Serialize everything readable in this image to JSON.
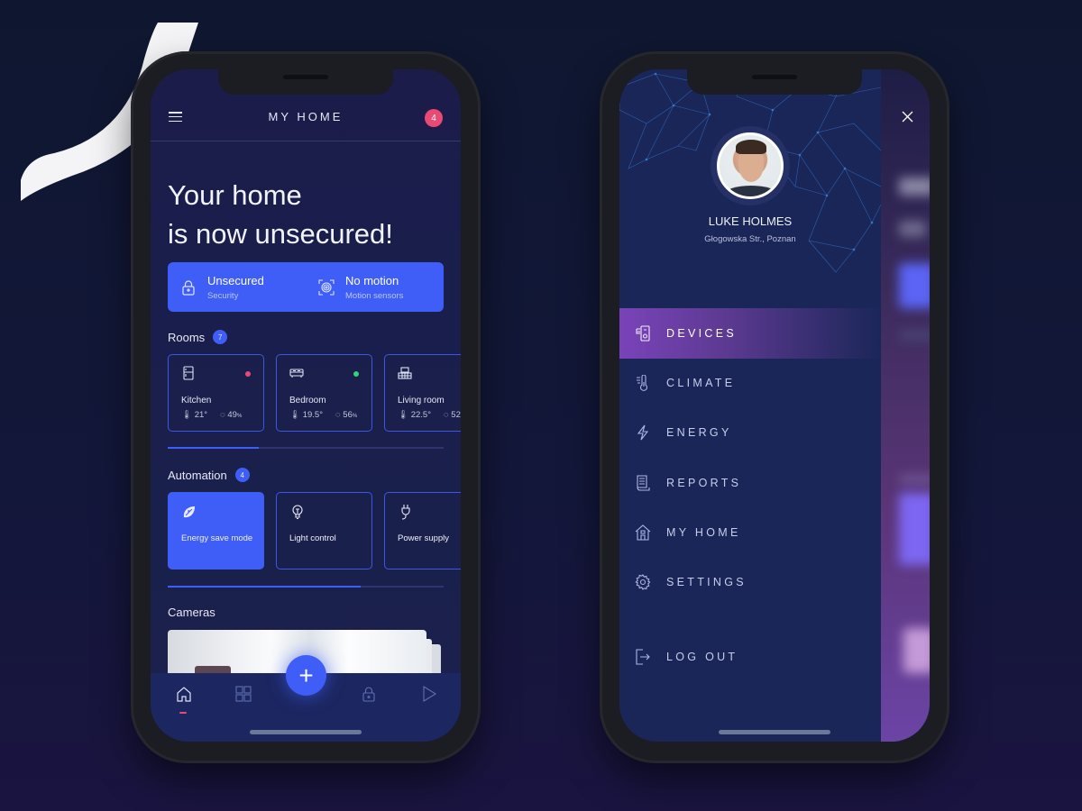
{
  "left_phone": {
    "header": {
      "title": "MY HOME",
      "notifications_count": "4"
    },
    "headline": {
      "line1": "Your home",
      "line2": "is now unsecured!"
    },
    "status_panel": [
      {
        "icon": "lock-icon",
        "title": "Unsecured",
        "subtitle": "Security"
      },
      {
        "icon": "motion-sensor-icon",
        "title": "No motion",
        "subtitle": "Motion sensors"
      }
    ],
    "rooms": {
      "label": "Rooms",
      "count": "7",
      "scroll_progress": 0.33,
      "items": [
        {
          "name": "Kitchen",
          "icon": "fridge-icon",
          "temperature": "21°",
          "humidity": "49",
          "humidity_unit": "%",
          "status_color": "#e94a73"
        },
        {
          "name": "Bedroom",
          "icon": "bed-icon",
          "temperature": "19.5°",
          "humidity": "56",
          "humidity_unit": "%",
          "status_color": "#2fd67b"
        },
        {
          "name": "Living room",
          "icon": "sofa-icon",
          "temperature": "22.5°",
          "humidity": "52",
          "humidity_unit": "%"
        }
      ]
    },
    "automation": {
      "label": "Automation",
      "count": "4",
      "scroll_progress": 0.7,
      "items": [
        {
          "name": "Energy save mode",
          "icon": "leaf-icon",
          "active": true
        },
        {
          "name": "Light control",
          "icon": "lightbulb-icon",
          "active": false
        },
        {
          "name": "Power supply",
          "icon": "plug-icon",
          "active": false
        }
      ]
    },
    "cameras": {
      "label": "Cameras"
    },
    "bottom_nav": [
      {
        "icon": "home-icon",
        "active": true
      },
      {
        "icon": "grid-icon"
      },
      {
        "icon": "plus-icon",
        "label": "+"
      },
      {
        "icon": "lock-icon"
      },
      {
        "icon": "play-icon"
      }
    ]
  },
  "right_phone": {
    "profile": {
      "name": "LUKE HOLMES",
      "address": "Głogowska Str., Poznan"
    },
    "menu": [
      {
        "label": "DEVICES",
        "icon": "devices-icon",
        "active": true
      },
      {
        "label": "CLIMATE",
        "icon": "thermometer-icon"
      },
      {
        "label": "ENERGY",
        "icon": "lightning-icon"
      },
      {
        "label": "REPORTS",
        "icon": "report-icon"
      },
      {
        "label": "MY HOME",
        "icon": "house-icon"
      },
      {
        "label": "SETTINGS",
        "icon": "gear-icon"
      }
    ],
    "logout": {
      "label": "LOG OUT",
      "icon": "logout-icon"
    }
  },
  "colors": {
    "accent": "#3f5ef8",
    "alert": "#e94a73",
    "ok": "#2fd67b",
    "menu_active": "#7a43b9"
  }
}
